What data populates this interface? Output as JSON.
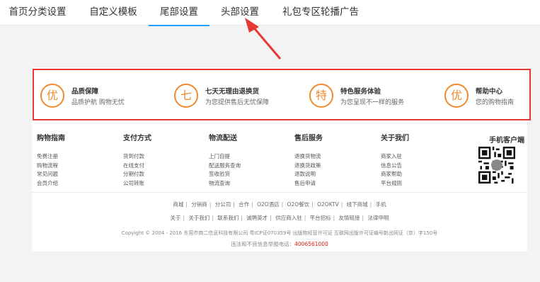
{
  "tabs": [
    {
      "label": "首页分类设置",
      "active": false
    },
    {
      "label": "自定义模板",
      "active": false
    },
    {
      "label": "尾部设置",
      "active": true
    },
    {
      "label": "头部设置",
      "active": false
    },
    {
      "label": "礼包专区轮播广告",
      "active": false
    }
  ],
  "services": [
    {
      "icon_char": "优",
      "title": "品质保障",
      "subtitle": "品质护航 购物无忧"
    },
    {
      "icon_char": "七",
      "title": "七天无理由退换货",
      "subtitle": "为您提供售后无忧保障"
    },
    {
      "icon_char": "特",
      "title": "特色服务体验",
      "subtitle": "为您呈现不一样的服务"
    },
    {
      "icon_char": "优",
      "title": "帮助中心",
      "subtitle": "您的购物指南"
    }
  ],
  "footer_columns": [
    {
      "title": "购物指南",
      "links": [
        "免费注册",
        "购物流程",
        "常见问题",
        "会员介绍"
      ]
    },
    {
      "title": "支付方式",
      "links": [
        "货到付款",
        "在线支付",
        "分期付款",
        "公司转账"
      ]
    },
    {
      "title": "物流配送",
      "links": [
        "上门自提",
        "配送服务查询",
        "签收验货",
        "物流查询"
      ]
    },
    {
      "title": "售后服务",
      "links": [
        "退换货物流",
        "退换货政策",
        "退款说明",
        "售后申请"
      ]
    },
    {
      "title": "关于我们",
      "links": [
        "商家入驻",
        "信息公告",
        "商家帮助",
        "平台规则"
      ]
    }
  ],
  "app_client_title": "手机客户端",
  "nav_row1": [
    "商城",
    "分销商",
    "分公司",
    "合作",
    "O2O酒店",
    "O2O餐饮",
    "O2OKTV",
    "线下商城",
    "手机"
  ],
  "nav_row2": [
    "关于",
    "关于我们",
    "联系我们",
    "诚聘英才",
    "供应商入驻",
    "平台招标",
    "友情链接",
    "法律申明"
  ],
  "copyright": "Copyight © 2004 - 2016 东莞市商二信息科技有限公司 粤ICP证070359号 出版物经营许可证 互联网出版许可证编号新出网证（京）字150号",
  "hotline_label": "违法和不良信息举报电话：",
  "hotline_number": "4006561000",
  "colors": {
    "accent_orange": "#f08a2c",
    "highlight_red": "#e53935",
    "tab_active": "#1e9fff",
    "hotline": "#e02020"
  }
}
